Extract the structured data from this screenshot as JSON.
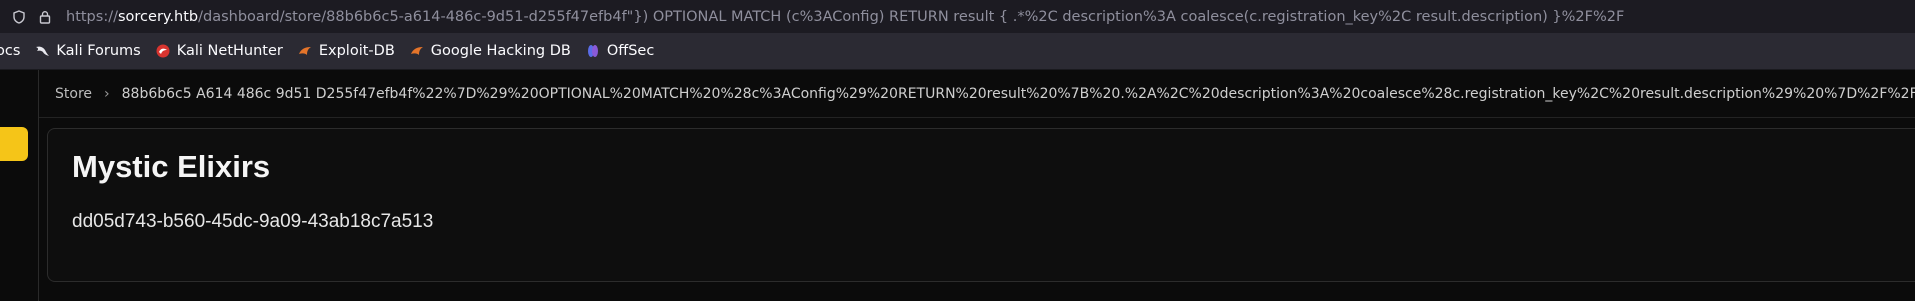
{
  "browser": {
    "url_scheme": "https://",
    "url_host": "sorcery.htb",
    "url_path": "/dashboard/store/88b6b6c5-a614-486c-9d51-d255f47efb4f\"}) OPTIONAL MATCH (c%3AConfig) RETURN result { .*%2C description%3A coalesce(c.registration_key%2C result.description) }%2F%2F",
    "icons": [
      "shield-icon",
      "lock-icon"
    ]
  },
  "bookmarks": [
    {
      "label": "ocs",
      "icon": ""
    },
    {
      "label": "Kali Forums",
      "icon": "kali-dragon-icon"
    },
    {
      "label": "Kali NetHunter",
      "icon": "nethunter-icon"
    },
    {
      "label": "Exploit-DB",
      "icon": "exploitdb-icon"
    },
    {
      "label": "Google Hacking DB",
      "icon": "ghdb-icon"
    },
    {
      "label": "OffSec",
      "icon": "offsec-icon"
    }
  ],
  "breadcrumb": {
    "store": "Store",
    "path": "88b6b6c5 A614 486c 9d51 D255f47efb4f%22%7D%29%20OPTIONAL%20MATCH%20%28c%3AConfig%29%20RETURN%20result%20%7B%20.%2A%2C%20description%3A%20coalesce%28c.registration_key%2C%20result.description%29%20%7D%2F%2F"
  },
  "product": {
    "title": "Mystic Elixirs",
    "description": "dd05d743-b560-45dc-9a09-43ab18c7a513"
  },
  "colors": {
    "accent": "#f5c518",
    "background": "#0b0b0b"
  }
}
